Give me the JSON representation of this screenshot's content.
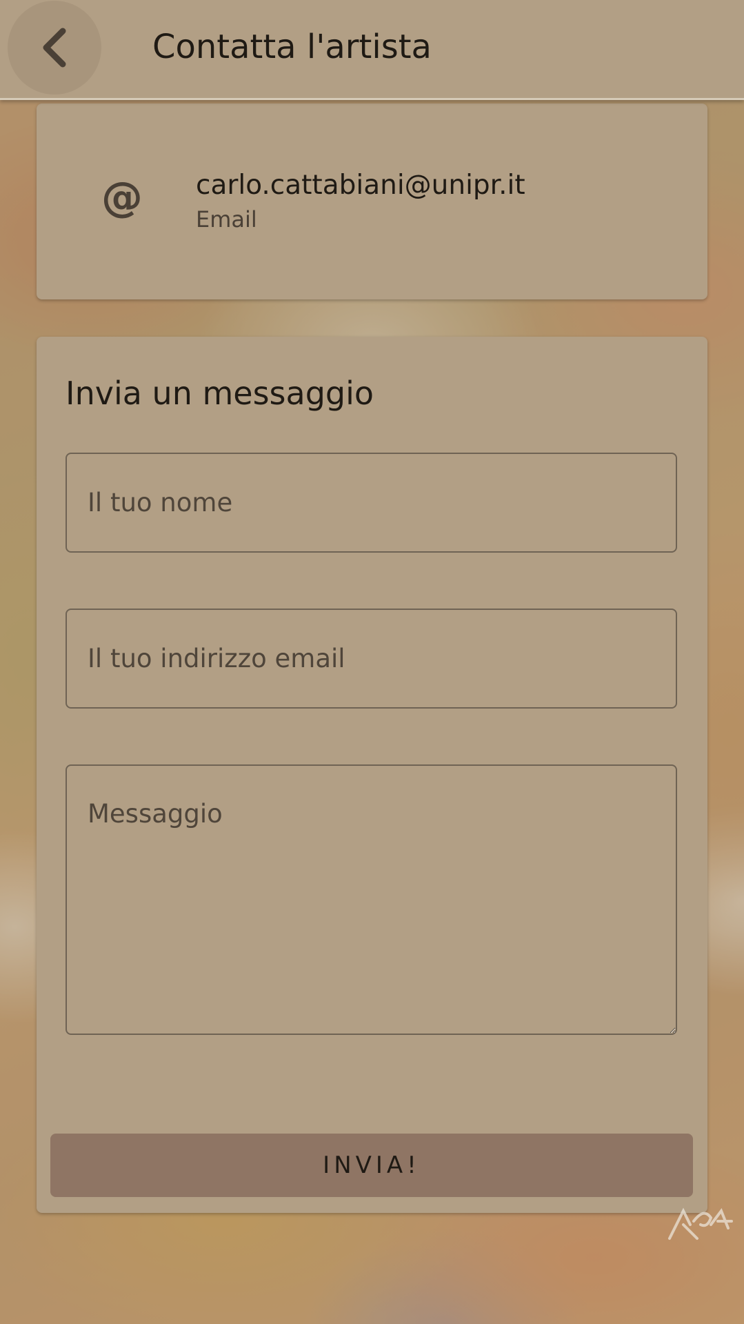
{
  "header": {
    "title": "Contatta l'artista",
    "back_icon": "chevron-left-icon"
  },
  "contact": {
    "icon": "at-icon",
    "value": "carlo.cattabiani@unipr.it",
    "type_label": "Email"
  },
  "form": {
    "title": "Invia un messaggio",
    "name_placeholder": "Il tuo nome",
    "email_placeholder": "Il tuo indirizzo email",
    "message_placeholder": "Messaggio",
    "submit_label": "INVIA!"
  },
  "colors": {
    "surface": "#b29f85",
    "button": "#8f7564",
    "text": "#1f1a14",
    "secondary_text": "#4a4036"
  }
}
